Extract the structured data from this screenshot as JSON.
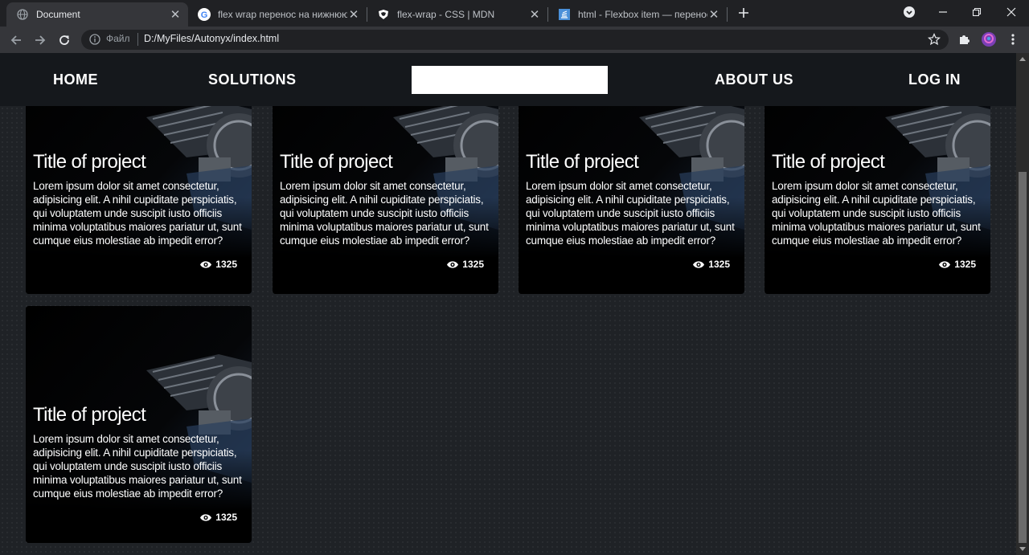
{
  "browser": {
    "tabs": [
      {
        "title": "Document",
        "icon": "globe-icon",
        "active": true
      },
      {
        "title": "flex wrap перенос на нижнюю с",
        "icon": "google-icon",
        "active": false
      },
      {
        "title": "flex-wrap - CSS | MDN",
        "icon": "mdn-icon",
        "active": false
      },
      {
        "title": "html - Flexbox item — перенос",
        "icon": "stackoverflow-icon",
        "active": false
      }
    ],
    "address_label": "Файл",
    "url": "D:/MyFiles/Autonyx/index.html"
  },
  "nav": {
    "home": "HOME",
    "solutions": "SOLUTIONS",
    "about": "ABOUT US",
    "login": "LOG IN",
    "search_value": ""
  },
  "cards": [
    {
      "title": "Title of project",
      "text": "Lorem ipsum dolor sit amet consectetur, adipisicing elit. A nihil cupiditate perspiciatis, qui voluptatem unde suscipit iusto officiis minima voluptatibus maiores pariatur ut, sunt cumque eius molestiae ab impedit error?",
      "views": "1325"
    },
    {
      "title": "Title of project",
      "text": "Lorem ipsum dolor sit amet consectetur, adipisicing elit. A nihil cupiditate perspiciatis, qui voluptatem unde suscipit iusto officiis minima voluptatibus maiores pariatur ut, sunt cumque eius molestiae ab impedit error?",
      "views": "1325"
    },
    {
      "title": "Title of project",
      "text": "Lorem ipsum dolor sit amet consectetur, adipisicing elit. A nihil cupiditate perspiciatis, qui voluptatem unde suscipit iusto officiis minima voluptatibus maiores pariatur ut, sunt cumque eius molestiae ab impedit error?",
      "views": "1325"
    },
    {
      "title": "Title of project",
      "text": "Lorem ipsum dolor sit amet consectetur, adipisicing elit. A nihil cupiditate perspiciatis, qui voluptatem unde suscipit iusto officiis minima voluptatibus maiores pariatur ut, sunt cumque eius molestiae ab impedit error?",
      "views": "1325"
    },
    {
      "title": "Title of project",
      "text": "Lorem ipsum dolor sit amet consectetur, adipisicing elit. A nihil cupiditate perspiciatis, qui voluptatem unde suscipit iusto officiis minima voluptatibus maiores pariatur ut, sunt cumque eius molestiae ab impedit error?",
      "views": "1325"
    }
  ],
  "colors": {
    "page_bg": "#1f2226",
    "nav_bg": "#15181c",
    "card_bg": "#000000",
    "chrome_tabbar": "#202124",
    "chrome_toolbar": "#35363a"
  }
}
